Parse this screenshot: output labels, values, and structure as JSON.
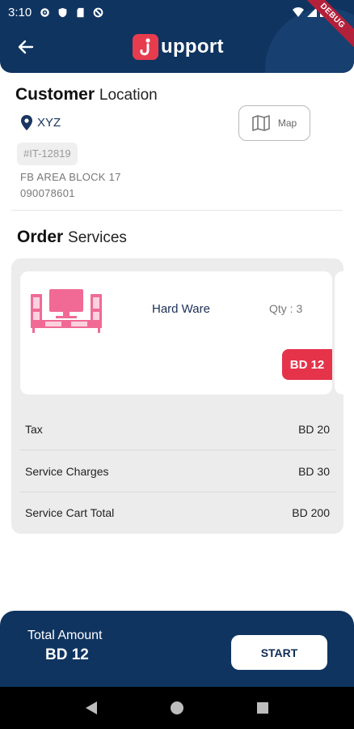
{
  "status_bar": {
    "time": "3:10",
    "debug_label": "DEBUG"
  },
  "header": {
    "logo_text": "upport",
    "logo_mark": "j"
  },
  "customer": {
    "title_bold": "Customer",
    "title_light": "Location",
    "location_name": "XYZ",
    "map_label": "Map",
    "order_id": "#IT-12819",
    "address_line": "FB AREA BLOCK 17",
    "phone": "090078601"
  },
  "order": {
    "title_bold": "Order",
    "title_light": "Services",
    "service": {
      "name": "Hard Ware",
      "qty": "Qty : 3",
      "price": "BD 12"
    },
    "summary": [
      {
        "label": "Tax",
        "value": "BD 20"
      },
      {
        "label": "Service Charges",
        "value": "BD 30"
      },
      {
        "label": "Service Cart Total",
        "value": "BD 200"
      }
    ]
  },
  "footer": {
    "total_label": "Total Amount",
    "total_value": "BD 12",
    "start_label": "START"
  },
  "colors": {
    "primary": "#0f3460",
    "accent": "#e5334a",
    "illustration": "#f06a95"
  }
}
